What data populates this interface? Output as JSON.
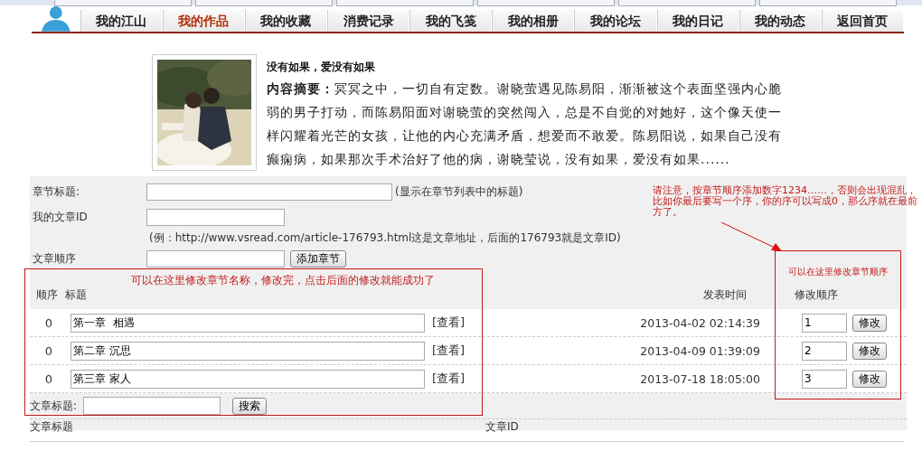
{
  "nav": {
    "items": [
      {
        "label": "我的江山",
        "selected": false
      },
      {
        "label": "我的作品",
        "selected": true
      },
      {
        "label": "我的收藏",
        "selected": false
      },
      {
        "label": "消费记录",
        "selected": false
      },
      {
        "label": "我的飞笺",
        "selected": false
      },
      {
        "label": "我的相册",
        "selected": false
      },
      {
        "label": "我的论坛",
        "selected": false
      },
      {
        "label": "我的日记",
        "selected": false
      },
      {
        "label": "我的动态",
        "selected": false
      },
      {
        "label": "返回首页",
        "selected": false
      }
    ]
  },
  "book": {
    "title": "没有如果，爱没有如果",
    "summary": "**内容摘要：**冥冥之中，一切自有定数。谢晓萤遇见陈易阳，渐渐被这个表面坚强内心脆弱的男子打动，而陈易阳面对谢晓萤的突然闯入，总是不自觉的对她好，这个像天使一样闪耀着光芒的女孩，让他的内心充满矛盾，想爱而不敢爱。陈易阳说，如果自己没有癫痫病，如果那次手术治好了他的病，谢晓莹说，没有如果，爱没有如果......"
  },
  "form": {
    "chapter_title_label": "章节标题:",
    "chapter_title_hint": "(显示在章节列表中的标题)",
    "article_id_label": "我的文章ID",
    "example": "(例：http://www.vsread.com/article-176793.html这是文章地址，后面的176793就是文章ID)",
    "order_label": "文章顺序",
    "add_button": "添加章节"
  },
  "table": {
    "columns": [
      "顺序",
      "标题",
      "发表时间",
      "修改顺序"
    ],
    "rows": [
      {
        "order": "0",
        "title": "第一章  相遇",
        "view": "[查看]",
        "time": "2013-04-02 02:14:39",
        "new_order": "1",
        "button": "修改"
      },
      {
        "order": "0",
        "title": "第二章 沉思",
        "view": "[查看]",
        "time": "2013-04-09 01:39:09",
        "new_order": "2",
        "button": "修改"
      },
      {
        "order": "0",
        "title": "第三章 家人",
        "view": "[查看]",
        "time": "2013-07-18 18:05:00",
        "new_order": "3",
        "button": "修改"
      }
    ]
  },
  "search": {
    "label": "文章标题:",
    "button": "搜索"
  },
  "bottom_columns": [
    "文章标题",
    "文章ID"
  ],
  "annotations": {
    "note": "请注意，按章节顺序添加数字1234……，否则会出现混乱，比如你最后要写一个序，你的序可以写成0，那么序就在最前方了。",
    "boxes": [
      "可以在这里修改章节名称，修改完，点击后面的修改就能成功了",
      "可以在这里修改章节顺序"
    ]
  }
}
